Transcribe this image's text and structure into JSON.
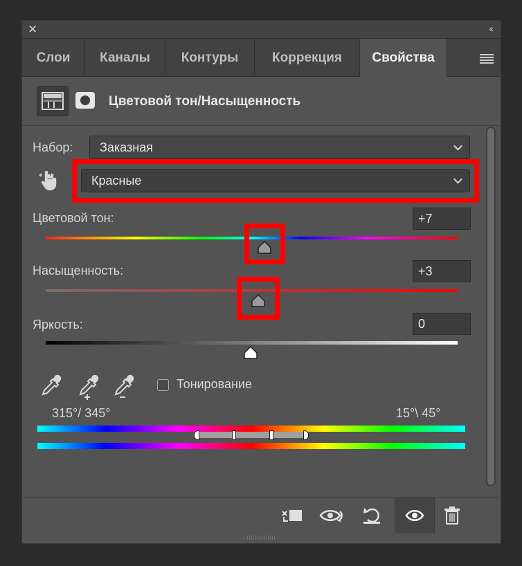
{
  "tabs": [
    {
      "label": "Слои",
      "active": false
    },
    {
      "label": "Каналы",
      "active": false
    },
    {
      "label": "Контуры",
      "active": false
    },
    {
      "label": "Коррекция",
      "active": false
    },
    {
      "label": "Свойства",
      "active": true
    }
  ],
  "header": {
    "title": "Цветовой тон/Насыщенность",
    "adjustment_icon": "hue-saturation-icon",
    "mask_icon": "layer-mask-icon"
  },
  "preset": {
    "label": "Набор:",
    "value": "Заказная"
  },
  "channel": {
    "value": "Красные"
  },
  "hue": {
    "label": "Цветовой тон:",
    "value": "+7"
  },
  "saturation": {
    "label": "Насыщенность:",
    "value": "+3"
  },
  "lightness": {
    "label": "Яркость:",
    "value": "0"
  },
  "colorize": {
    "label": "Тонирование",
    "checked": false
  },
  "range": {
    "left": "315°/ 345°",
    "right": "15°\\ 45°"
  },
  "icons": {
    "close": "close-icon",
    "collapse": "collapse-icon",
    "menu": "panel-menu-icon",
    "hand": "targeted-adjustment-icon",
    "eyedropper": "eyedropper-icon",
    "eyedropper_add": "eyedropper-plus-icon",
    "eyedropper_sub": "eyedropper-minus-icon",
    "clip": "clip-to-layer-icon",
    "view_prev": "view-previous-state-icon",
    "reset": "reset-icon",
    "visibility": "eye-icon",
    "delete": "trash-icon"
  },
  "colors": {
    "highlight": "#ff0000",
    "panel": "#535353"
  }
}
